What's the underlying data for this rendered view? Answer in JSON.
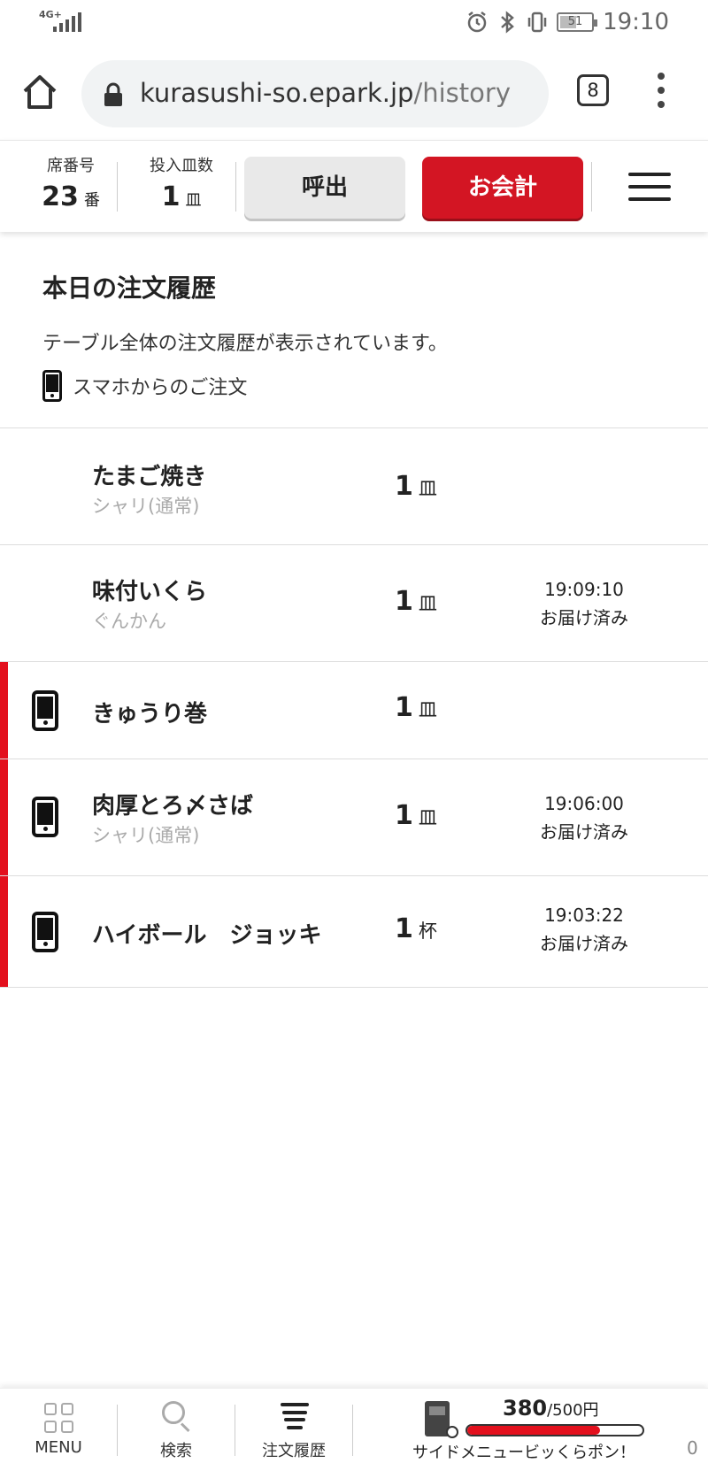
{
  "status_bar": {
    "network": "4G+",
    "battery": "51",
    "time": "19:10"
  },
  "browser": {
    "url_domain": "kurasushi-so.epark.jp",
    "url_path": "/history",
    "tab_count": "8"
  },
  "header": {
    "seat_label": "席番号",
    "seat_number": "23",
    "seat_unit": "番",
    "plates_label": "投入皿数",
    "plates_count": "1",
    "plates_unit": "皿",
    "call_button": "呼出",
    "checkout_button": "お会計"
  },
  "intro": {
    "title": "本日の注文履歴",
    "description": "テーブル全体の注文履歴が表示されています。",
    "legend": "スマホからのご注文"
  },
  "orders": [
    {
      "name": "たまご焼き",
      "option": "シャリ(通常)",
      "qty": "1",
      "unit": "皿",
      "time": "",
      "status": "",
      "from_phone": false
    },
    {
      "name": "味付いくら",
      "option": "ぐんかん",
      "qty": "1",
      "unit": "皿",
      "time": "19:09:10",
      "status": "お届け済み",
      "from_phone": false
    },
    {
      "name": "きゅうり巻",
      "option": "",
      "qty": "1",
      "unit": "皿",
      "time": "",
      "status": "",
      "from_phone": true
    },
    {
      "name": "肉厚とろ〆さば",
      "option": "シャリ(通常)",
      "qty": "1",
      "unit": "皿",
      "time": "19:06:00",
      "status": "お届け済み",
      "from_phone": true
    },
    {
      "name": "ハイボール　ジョッキ",
      "option": "",
      "qty": "1",
      "unit": "杯",
      "time": "19:03:22",
      "status": "お届け済み",
      "from_phone": true
    }
  ],
  "bottom_nav": {
    "menu": "MENU",
    "search": "検索",
    "history": "注文履歴",
    "promo_amount": "380",
    "promo_goal": "/500円",
    "promo_progress": 0.76,
    "promo_label": "サイドメニュービッくらポン！",
    "corner_value": "0"
  },
  "colors": {
    "brand_red": "#d31523",
    "mobile_marker": "#e3101d"
  }
}
